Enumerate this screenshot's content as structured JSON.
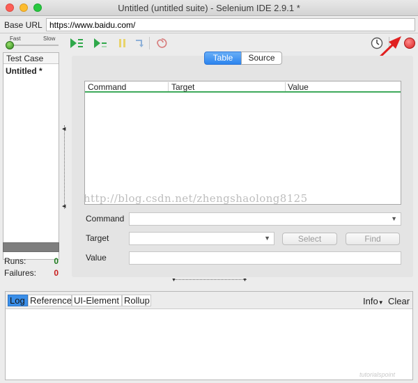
{
  "window": {
    "title": "Untitled (untitled suite) - Selenium IDE 2.9.1 *"
  },
  "base_url": {
    "label": "Base URL",
    "value": "https://www.baidu.com/"
  },
  "speed": {
    "fast_label": "Fast",
    "slow_label": "Slow"
  },
  "toolbar": {
    "icons": [
      "play-all-icon",
      "play-current-icon",
      "pause-icon",
      "step-icon",
      "rollup-icon",
      "clock-icon",
      "dropdown-arrow-icon",
      "record-icon"
    ]
  },
  "test_case_panel": {
    "header": "Test Case",
    "items": [
      "Untitled *"
    ]
  },
  "stats": {
    "runs_label": "Runs:",
    "runs_value": "0",
    "failures_label": "Failures:",
    "failures_value": "0"
  },
  "editor": {
    "tabs": [
      "Table",
      "Source"
    ],
    "columns": [
      "Command",
      "Target",
      "Value"
    ],
    "watermark": "http://blog.csdn.net/zhengshaolong8125",
    "command_label": "Command",
    "target_label": "Target",
    "value_label": "Value",
    "command_value": "",
    "target_value": "",
    "value_value": "",
    "select_button": "Select",
    "find_button": "Find"
  },
  "log_panel": {
    "tabs": [
      "Log",
      "Reference",
      "UI-Element",
      "Rollup"
    ],
    "info_label": "Info",
    "clear_label": "Clear",
    "corner_watermark": "tutorialspoint"
  },
  "colors": {
    "record": "#d92020",
    "play": "#2fa84a",
    "active_tab": "#2c84ee",
    "runs": "#1e7b1e",
    "failures": "#c81d1d",
    "arrow": "#e02020"
  }
}
